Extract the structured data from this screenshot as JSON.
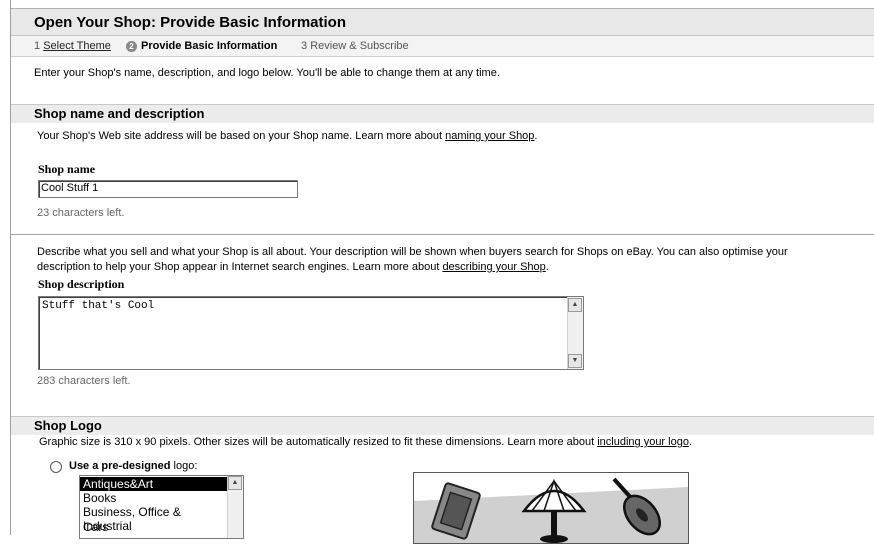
{
  "header": {
    "title": "Open Your Shop: Provide Basic Information"
  },
  "steps": [
    {
      "num": "1",
      "label": "Select Theme"
    },
    {
      "num": "2",
      "label": "Provide Basic Information"
    },
    {
      "num": "3",
      "label": "Review & Subscribe"
    }
  ],
  "intro": "Enter your Shop's name, description, and logo below. You'll be able to change them at any time.",
  "name_section": {
    "title": "Shop name and description",
    "help_text": "Your Shop's Web site address will be based on your Shop name. Learn more about ",
    "help_link": "naming your Shop",
    "help_end": ".",
    "name_label": "Shop name",
    "name_value": "Cool Stuff 1",
    "name_remaining": "23 characters left.",
    "desc_help_line1": "Describe what you sell and what your Shop is all about. Your description will be shown when buyers search for Shops on eBay. You can also optimise your",
    "desc_help_line2": "description to help your Shop appear in Internet search engines. Learn more about ",
    "desc_help_link": "describing your Shop",
    "desc_help_end": ".",
    "desc_label": "Shop description",
    "desc_value": "Stuff that's Cool",
    "desc_remaining": "283 characters left."
  },
  "logo_section": {
    "title": "Shop Logo",
    "help_text": "Graphic size is 310 x 90 pixels. Other sizes will be automatically resized to fit these dimensions. Learn more about ",
    "help_link": "including your logo",
    "help_end": ".",
    "option_bold": "Use a pre-designed",
    "option_rest": " logo:",
    "categories": [
      "Antiques&Art",
      "Books",
      "Business, Office & Industrial",
      "Cars"
    ],
    "selected_index": 0
  },
  "colors": {
    "header_bg": "#e8e8e8",
    "section_bg": "#ececec",
    "link": "#000000"
  }
}
